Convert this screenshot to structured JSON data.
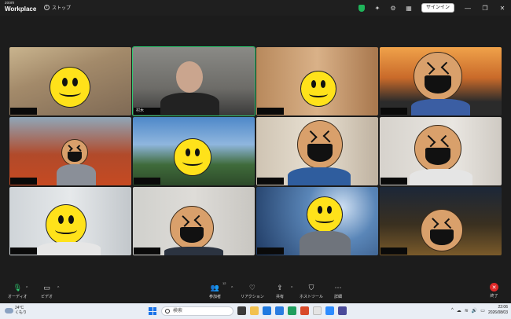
{
  "titlebar": {
    "logo_top": "zoom",
    "logo_bottom": "Workplace",
    "stop_label": "ストップ",
    "signin_label": "サインイン"
  },
  "participants": [
    {
      "name": "",
      "avatar": "smile-icon"
    },
    {
      "name": "村木",
      "avatar": "none"
    },
    {
      "name": "",
      "avatar": "smile-icon"
    },
    {
      "name": "",
      "avatar": "laugh-icon"
    },
    {
      "name": "",
      "avatar": "laugh-icon"
    },
    {
      "name": "",
      "avatar": "smile-icon"
    },
    {
      "name": "",
      "avatar": "laugh-icon"
    },
    {
      "name": "",
      "avatar": "laugh-icon"
    },
    {
      "name": "",
      "avatar": "smile-icon"
    },
    {
      "name": "",
      "avatar": "laugh-icon"
    },
    {
      "name": "",
      "avatar": "smile-icon"
    },
    {
      "name": "",
      "avatar": "laugh-icon"
    }
  ],
  "toolbar": {
    "audio_label": "オーディオ",
    "video_label": "ビデオ",
    "participants_label": "参加者",
    "participants_count": "12",
    "reaction_label": "リアクション",
    "share_label": "共有",
    "host_tools_label": "ホストツール",
    "details_label": "詳細",
    "end_label": "終了"
  },
  "taskbar": {
    "temperature": "24°C",
    "weather": "くもり",
    "search_placeholder": "検索",
    "time": "22:06",
    "date": "2026/08/03"
  },
  "colors": {
    "active_speaker": "#2ecc71",
    "end_button": "#e02828",
    "shield": "#1fb45a"
  }
}
